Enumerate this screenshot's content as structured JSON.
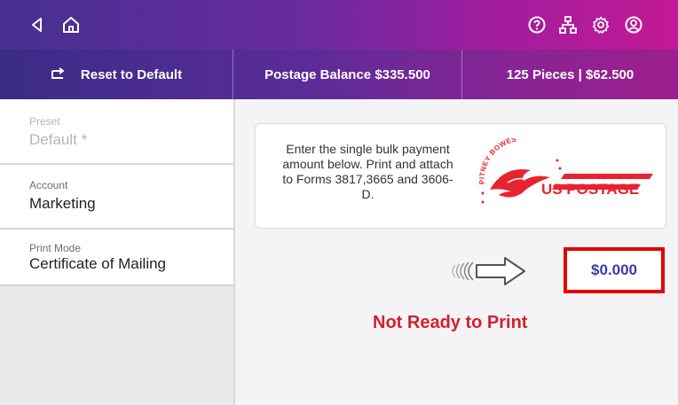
{
  "topbar": {
    "icons": [
      "back-icon",
      "home-icon",
      "help-icon",
      "network-icon",
      "settings-icon",
      "account-icon"
    ]
  },
  "subbar": {
    "reset_label": "Reset to Default",
    "balance_label": "Postage Balance $335.500",
    "pieces_label": "125 Pieces | $62.500"
  },
  "sidebar": {
    "items": [
      {
        "label": "Preset",
        "value": "Default *",
        "enabled": false
      },
      {
        "label": "Account",
        "value": "Marketing",
        "enabled": true
      },
      {
        "label": "Print Mode",
        "value": "Certificate of Mailing",
        "enabled": true
      }
    ]
  },
  "main": {
    "instructions": "Enter the single bulk payment amount below. Print and attach to Forms 3817,3665 and 3606-D.",
    "stamp": {
      "brand_text": "PITNEY BOWES",
      "postage_text": "US POSTAGE"
    },
    "amount_value": "$0.000",
    "status_text": "Not Ready to Print"
  },
  "colors": {
    "accent": "#5b2c97",
    "brand_red": "#e8232f",
    "highlight_box": "#e60000",
    "amount_text": "#3a3ab0"
  }
}
